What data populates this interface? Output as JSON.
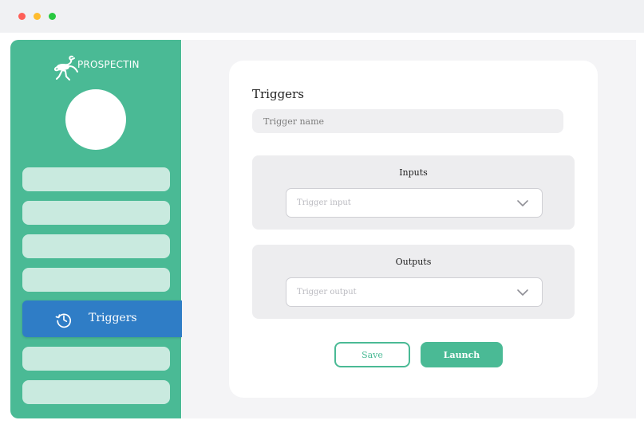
{
  "window": {
    "controls": {
      "close_color": "#fe5f57",
      "minimize_color": "#febc2e",
      "maximize_color": "#28c840"
    }
  },
  "colors": {
    "brand_green": "#4aba95",
    "nav_light": "#c9eadf",
    "active_blue": "#2f7dc6"
  },
  "sidebar": {
    "logo_text": "PROSPECTIN",
    "logo_icon": "ostrich-logo-icon",
    "active_item": {
      "label": "Triggers",
      "icon": "history-icon"
    }
  },
  "card": {
    "title": "Triggers",
    "trigger_name_placeholder": "Trigger name",
    "inputs": {
      "title": "Inputs",
      "placeholder": "Trigger input"
    },
    "outputs": {
      "title": "Outputs",
      "placeholder": "Trigger output"
    },
    "save_label": "Save",
    "launch_label": "Launch"
  }
}
